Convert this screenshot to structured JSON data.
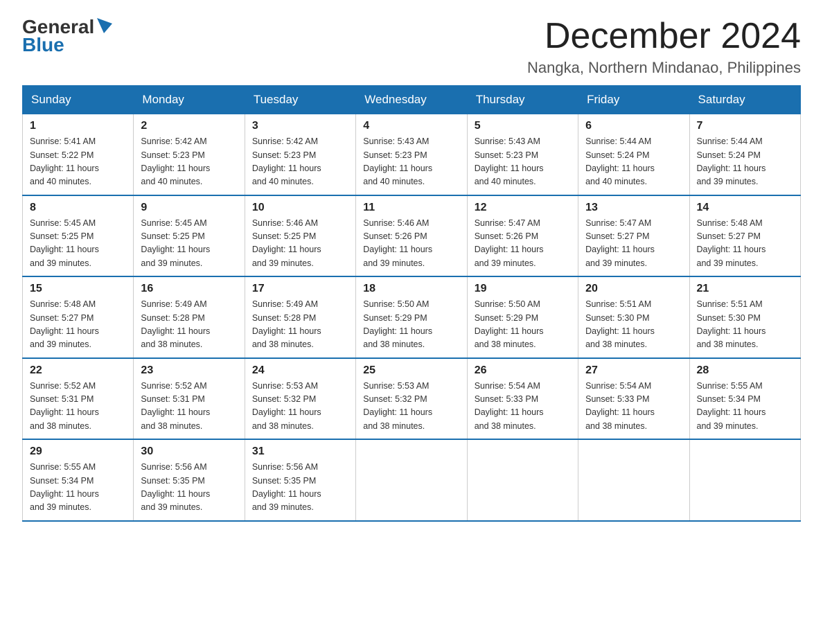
{
  "header": {
    "logo_line1": "General",
    "logo_line2": "Blue",
    "title": "December 2024",
    "subtitle": "Nangka, Northern Mindanao, Philippines"
  },
  "days_of_week": [
    "Sunday",
    "Monday",
    "Tuesday",
    "Wednesday",
    "Thursday",
    "Friday",
    "Saturday"
  ],
  "weeks": [
    [
      {
        "day": "1",
        "sunrise": "5:41 AM",
        "sunset": "5:22 PM",
        "daylight": "11 hours and 40 minutes."
      },
      {
        "day": "2",
        "sunrise": "5:42 AM",
        "sunset": "5:23 PM",
        "daylight": "11 hours and 40 minutes."
      },
      {
        "day": "3",
        "sunrise": "5:42 AM",
        "sunset": "5:23 PM",
        "daylight": "11 hours and 40 minutes."
      },
      {
        "day": "4",
        "sunrise": "5:43 AM",
        "sunset": "5:23 PM",
        "daylight": "11 hours and 40 minutes."
      },
      {
        "day": "5",
        "sunrise": "5:43 AM",
        "sunset": "5:23 PM",
        "daylight": "11 hours and 40 minutes."
      },
      {
        "day": "6",
        "sunrise": "5:44 AM",
        "sunset": "5:24 PM",
        "daylight": "11 hours and 40 minutes."
      },
      {
        "day": "7",
        "sunrise": "5:44 AM",
        "sunset": "5:24 PM",
        "daylight": "11 hours and 39 minutes."
      }
    ],
    [
      {
        "day": "8",
        "sunrise": "5:45 AM",
        "sunset": "5:25 PM",
        "daylight": "11 hours and 39 minutes."
      },
      {
        "day": "9",
        "sunrise": "5:45 AM",
        "sunset": "5:25 PM",
        "daylight": "11 hours and 39 minutes."
      },
      {
        "day": "10",
        "sunrise": "5:46 AM",
        "sunset": "5:25 PM",
        "daylight": "11 hours and 39 minutes."
      },
      {
        "day": "11",
        "sunrise": "5:46 AM",
        "sunset": "5:26 PM",
        "daylight": "11 hours and 39 minutes."
      },
      {
        "day": "12",
        "sunrise": "5:47 AM",
        "sunset": "5:26 PM",
        "daylight": "11 hours and 39 minutes."
      },
      {
        "day": "13",
        "sunrise": "5:47 AM",
        "sunset": "5:27 PM",
        "daylight": "11 hours and 39 minutes."
      },
      {
        "day": "14",
        "sunrise": "5:48 AM",
        "sunset": "5:27 PM",
        "daylight": "11 hours and 39 minutes."
      }
    ],
    [
      {
        "day": "15",
        "sunrise": "5:48 AM",
        "sunset": "5:27 PM",
        "daylight": "11 hours and 39 minutes."
      },
      {
        "day": "16",
        "sunrise": "5:49 AM",
        "sunset": "5:28 PM",
        "daylight": "11 hours and 38 minutes."
      },
      {
        "day": "17",
        "sunrise": "5:49 AM",
        "sunset": "5:28 PM",
        "daylight": "11 hours and 38 minutes."
      },
      {
        "day": "18",
        "sunrise": "5:50 AM",
        "sunset": "5:29 PM",
        "daylight": "11 hours and 38 minutes."
      },
      {
        "day": "19",
        "sunrise": "5:50 AM",
        "sunset": "5:29 PM",
        "daylight": "11 hours and 38 minutes."
      },
      {
        "day": "20",
        "sunrise": "5:51 AM",
        "sunset": "5:30 PM",
        "daylight": "11 hours and 38 minutes."
      },
      {
        "day": "21",
        "sunrise": "5:51 AM",
        "sunset": "5:30 PM",
        "daylight": "11 hours and 38 minutes."
      }
    ],
    [
      {
        "day": "22",
        "sunrise": "5:52 AM",
        "sunset": "5:31 PM",
        "daylight": "11 hours and 38 minutes."
      },
      {
        "day": "23",
        "sunrise": "5:52 AM",
        "sunset": "5:31 PM",
        "daylight": "11 hours and 38 minutes."
      },
      {
        "day": "24",
        "sunrise": "5:53 AM",
        "sunset": "5:32 PM",
        "daylight": "11 hours and 38 minutes."
      },
      {
        "day": "25",
        "sunrise": "5:53 AM",
        "sunset": "5:32 PM",
        "daylight": "11 hours and 38 minutes."
      },
      {
        "day": "26",
        "sunrise": "5:54 AM",
        "sunset": "5:33 PM",
        "daylight": "11 hours and 38 minutes."
      },
      {
        "day": "27",
        "sunrise": "5:54 AM",
        "sunset": "5:33 PM",
        "daylight": "11 hours and 38 minutes."
      },
      {
        "day": "28",
        "sunrise": "5:55 AM",
        "sunset": "5:34 PM",
        "daylight": "11 hours and 39 minutes."
      }
    ],
    [
      {
        "day": "29",
        "sunrise": "5:55 AM",
        "sunset": "5:34 PM",
        "daylight": "11 hours and 39 minutes."
      },
      {
        "day": "30",
        "sunrise": "5:56 AM",
        "sunset": "5:35 PM",
        "daylight": "11 hours and 39 minutes."
      },
      {
        "day": "31",
        "sunrise": "5:56 AM",
        "sunset": "5:35 PM",
        "daylight": "11 hours and 39 minutes."
      },
      null,
      null,
      null,
      null
    ]
  ],
  "labels": {
    "sunrise": "Sunrise:",
    "sunset": "Sunset:",
    "daylight": "Daylight:"
  }
}
